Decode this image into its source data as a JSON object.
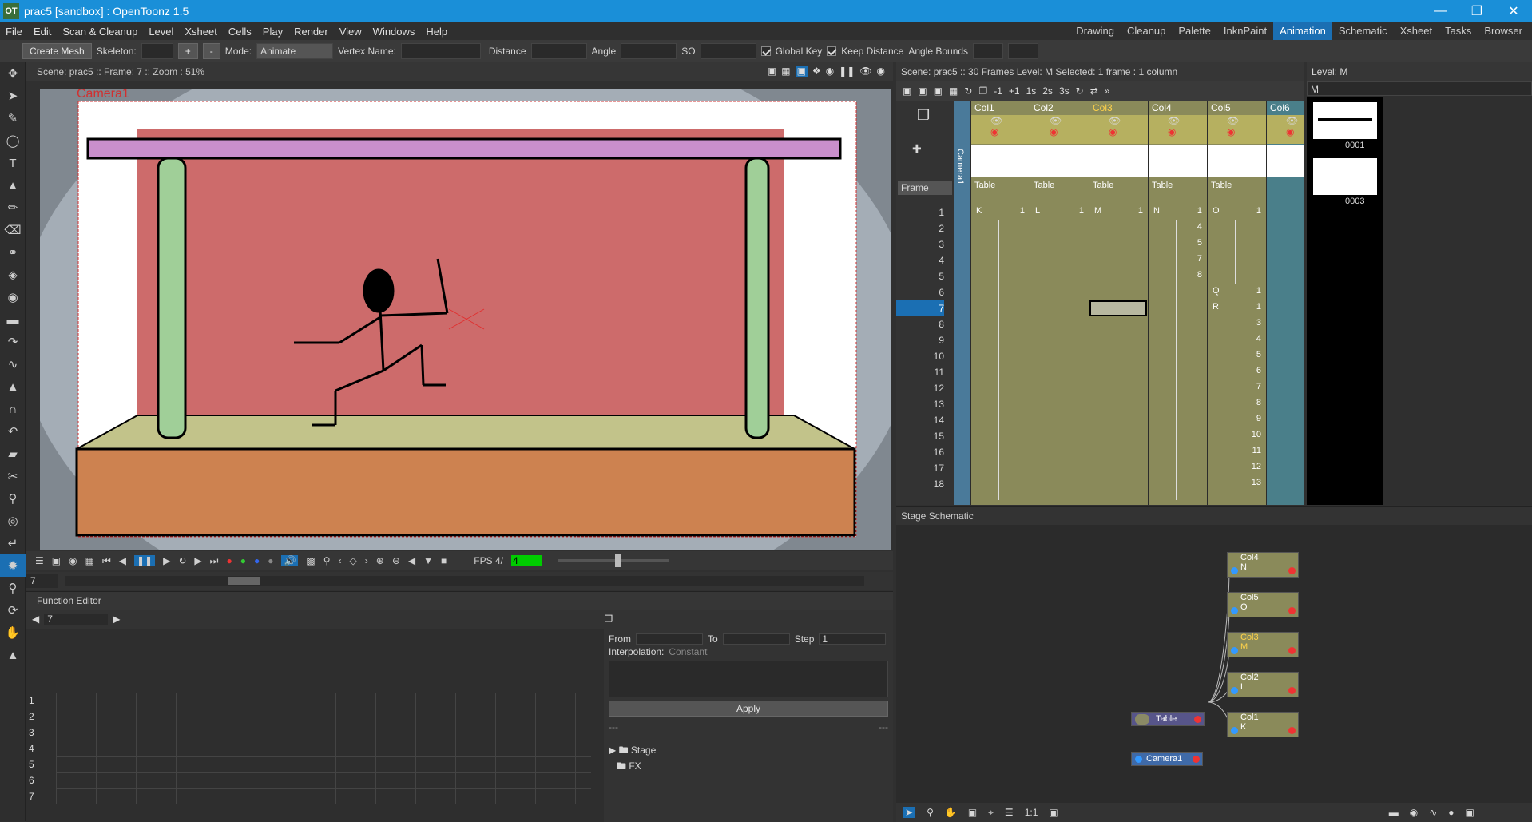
{
  "window": {
    "title": "prac5 [sandbox] : OpenToonz 1.5",
    "logo": "OT",
    "buttons": [
      "minimize-icon",
      "restore-icon",
      "close-icon"
    ]
  },
  "menu": [
    "File",
    "Edit",
    "Scan & Cleanup",
    "Level",
    "Xsheet",
    "Cells",
    "Play",
    "Render",
    "View",
    "Windows",
    "Help"
  ],
  "rooms": [
    "Drawing",
    "Cleanup",
    "Palette",
    "InknPaint",
    "Animation",
    "Schematic",
    "Xsheet",
    "Tasks",
    "Browser"
  ],
  "active_room": "Animation",
  "tool_options": {
    "create_mesh": "Create Mesh",
    "skeleton_label": "Skeleton:",
    "plus": "+",
    "minus": "-",
    "mode_label": "Mode:",
    "mode_value": "Animate",
    "vertex_name_label": "Vertex Name:",
    "distance_label": "Distance",
    "angle_label": "Angle",
    "so_label": "SO",
    "global_key": "Global Key",
    "keep_distance": "Keep Distance",
    "angle_bounds": "Angle Bounds"
  },
  "viewer": {
    "header": "Scene: prac5  ::  Frame: 7  ::  Zoom : 51%",
    "camera_label": "Camera1",
    "fps_label": "FPS 4/",
    "fps_value": "4",
    "frame_field": "7"
  },
  "function_editor": {
    "title": "Function Editor",
    "frame_value": "7",
    "from_label": "From",
    "to_label": "To",
    "step_label": "Step",
    "step_value": "1",
    "interpolation_label": "Interpolation:",
    "interpolation_value": "Constant",
    "apply": "Apply",
    "dash1": "---",
    "dash2": "---",
    "rows": [
      "1",
      "2",
      "3",
      "4",
      "5",
      "6",
      "7"
    ],
    "tree": [
      "Stage",
      "FX"
    ]
  },
  "xsheet": {
    "header": "Scene: prac5  ::  30 Frames  Level: M   Selected: 1 frame : 1 column",
    "frame_dropdown": "Frame",
    "camera_col": "Camera1",
    "columns": [
      {
        "name": "Col1",
        "level": "Table",
        "cells": [
          "K",
          "1"
        ]
      },
      {
        "name": "Col2",
        "level": "Table",
        "cells": [
          "L",
          "1"
        ]
      },
      {
        "name": "Col3",
        "level": "Table",
        "cells": [
          "M",
          "1"
        ]
      },
      {
        "name": "Col4",
        "level": "Table",
        "cells": [
          "N",
          "1",
          "4",
          "5",
          "7",
          "8"
        ]
      },
      {
        "name": "Col5",
        "level": "Table",
        "cells": [
          "O",
          "1"
        ]
      },
      {
        "name": "Col6",
        "level": "",
        "cells": []
      }
    ],
    "tool_labels": [
      "-1",
      "+1",
      "1s",
      "2s",
      "3s"
    ],
    "col5_extra": [
      {
        "r": 6,
        "l": "Q",
        "v": "1"
      },
      {
        "r": 7,
        "l": "R",
        "v": "1"
      },
      {
        "r": 8,
        "v": "3"
      },
      {
        "r": 9,
        "v": "4"
      },
      {
        "r": 10,
        "v": "5"
      },
      {
        "r": 11,
        "v": "6"
      },
      {
        "r": 12,
        "v": "7"
      },
      {
        "r": 13,
        "v": "8"
      },
      {
        "r": 14,
        "v": "9"
      },
      {
        "r": 15,
        "v": "10"
      },
      {
        "r": 16,
        "v": "11"
      },
      {
        "r": 17,
        "v": "12"
      },
      {
        "r": 18,
        "v": "13"
      }
    ],
    "frames": [
      "1",
      "2",
      "3",
      "4",
      "5",
      "6",
      "7",
      "8",
      "9",
      "10",
      "11",
      "12",
      "13",
      "14",
      "15",
      "16",
      "17",
      "18"
    ],
    "current_frame": "7"
  },
  "level_strip": {
    "title": "Level: M",
    "level_name": "M",
    "frames": [
      "0001",
      "0003"
    ]
  },
  "schematic": {
    "title": "Stage Schematic",
    "nodes": [
      {
        "name": "Col4",
        "sub": "N"
      },
      {
        "name": "Col5",
        "sub": "O"
      },
      {
        "name": "Col3",
        "sub": "M"
      },
      {
        "name": "Col2",
        "sub": "L"
      },
      {
        "name": "Col1",
        "sub": "K"
      }
    ],
    "table": "Table",
    "camera": "Camera1",
    "zoom_label": "1:1"
  },
  "colors": {
    "accent": "#1b6fb3",
    "titlebar": "#1a8fd8",
    "column_olive": "#8a8a5a",
    "selected_col": "#ffd24a"
  }
}
